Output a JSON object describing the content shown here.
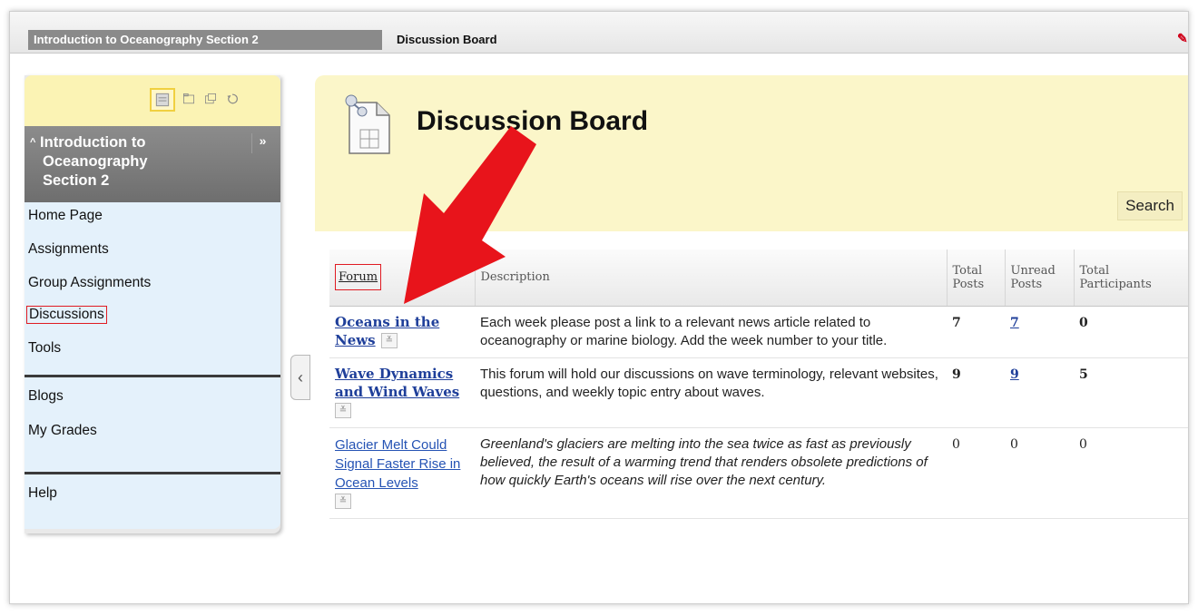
{
  "breadcrumb": {
    "course": "Introduction to Oceanography Section 2",
    "page": "Discussion Board"
  },
  "course_menu": {
    "title_line1": "Introduction to",
    "title_line2": "Oceanography",
    "title_line3": "Section 2",
    "expand": "»",
    "items": [
      {
        "label": "Home Page"
      },
      {
        "label": "Assignments"
      },
      {
        "label": "Group Assignments"
      },
      {
        "label": "Discussions"
      },
      {
        "label": "Tools"
      },
      {
        "label": "Blogs"
      },
      {
        "label": "My Grades"
      },
      {
        "label": "Help"
      }
    ]
  },
  "header": {
    "title": "Discussion Board",
    "search_label": "Search"
  },
  "table": {
    "columns": [
      "Forum",
      "Description",
      "Total Posts",
      "Unread Posts",
      "Total Participants"
    ],
    "col_total_posts_l1": "Total",
    "col_total_posts_l2": "Posts",
    "col_unread_l1": "Unread",
    "col_unread_l2": "Posts",
    "col_participants_l1": "Total",
    "col_participants_l2": "Participants",
    "rows": [
      {
        "forum": "Oceans in the News",
        "description": "Each week please post a link to a relevant news article related to oceanography or marine biology. Add the week number to your title.",
        "total_posts": "7",
        "unread_posts": "7",
        "participants": "0"
      },
      {
        "forum": "Wave Dynamics and Wind Waves",
        "description": "This forum will hold our discussions on wave terminology, relevant websites, questions, and weekly topic entry about waves.",
        "total_posts": "9",
        "unread_posts": "9",
        "participants": "5"
      },
      {
        "forum": "Glacier Melt Could Signal Faster Rise in Ocean Levels",
        "description": "Greenland's glaciers are melting into the sea twice as fast as previously believed, the result of a warming trend that renders obsolete predictions of how quickly Earth's oceans will rise over the next century.",
        "total_posts": "0",
        "unread_posts": "0",
        "participants": "0"
      }
    ]
  },
  "colors": {
    "highlight_red": "#e01b22",
    "link_blue": "#1f3f9a",
    "header_yellow": "#fbf6c9",
    "menu_blue": "#e4f1fb"
  }
}
